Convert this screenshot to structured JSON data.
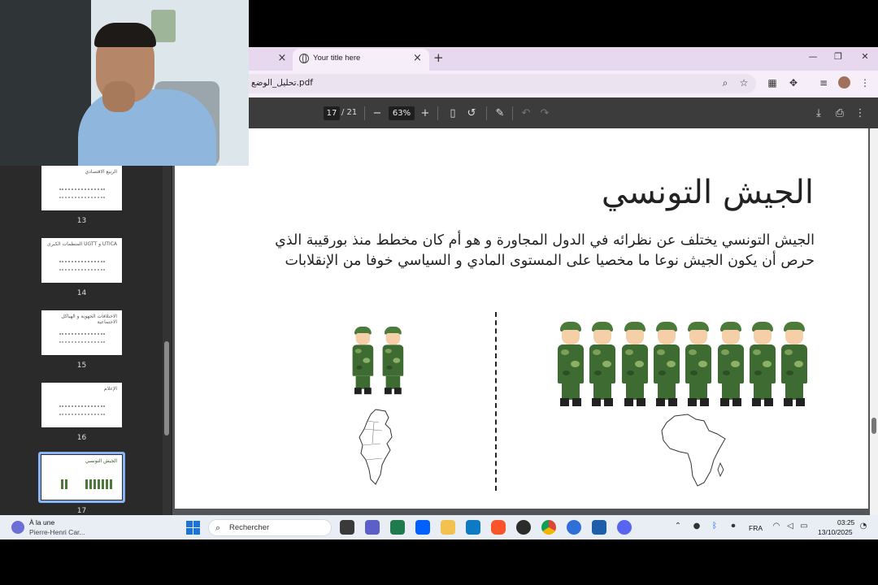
{
  "browser": {
    "active_tab_title": "Your title here",
    "inactive_tab_close": "×",
    "active_tab_close": "×",
    "new_tab": "+",
    "window_minimize": "—",
    "window_restore": "❐",
    "window_close": "✕",
    "url": "تحليل_الوضع.pdf"
  },
  "pdf_toolbar": {
    "current_page": "17",
    "total_pages": "/ 21",
    "zoom": "63%",
    "zoom_out": "−",
    "zoom_in": "+"
  },
  "sidebar": {
    "thumbnails": [
      {
        "number": "13",
        "title": "الربيع الاقتصادي"
      },
      {
        "number": "14",
        "title": "UTICA و UGTT المنظمات الكبرى"
      },
      {
        "number": "15",
        "title": "الاختلافات الجهوية و الهياكل الاجتماعية"
      },
      {
        "number": "16",
        "title": "الإعلام"
      },
      {
        "number": "17",
        "title": "الجيش التونسي"
      }
    ]
  },
  "slide": {
    "title": "الجيش التونسي",
    "body": "الجيش التونسي يختلف عن نظرائه في الدول المجاورة و هو أم كان مخطط منذ بورقيبة الذي حرص أن يكون الجيش نوعا ما مخصيا على المستوى المادي و السياسي خوفا من الإنقلابات",
    "left_group_soldier_count": 2,
    "right_group_soldier_count": 8
  },
  "taskbar": {
    "weather_line1": "À la une",
    "weather_line2": "Pierre-Henri Car...",
    "search_placeholder": "Rechercher",
    "language": "FRA",
    "time": "03:25",
    "date": "13/10/2025"
  },
  "colors": {
    "tab_strip": "#e7d8f0",
    "pdf_toolbar": "#3c3c3c",
    "sidebar": "#2a2a2a",
    "accent": "#8ab4f8"
  }
}
